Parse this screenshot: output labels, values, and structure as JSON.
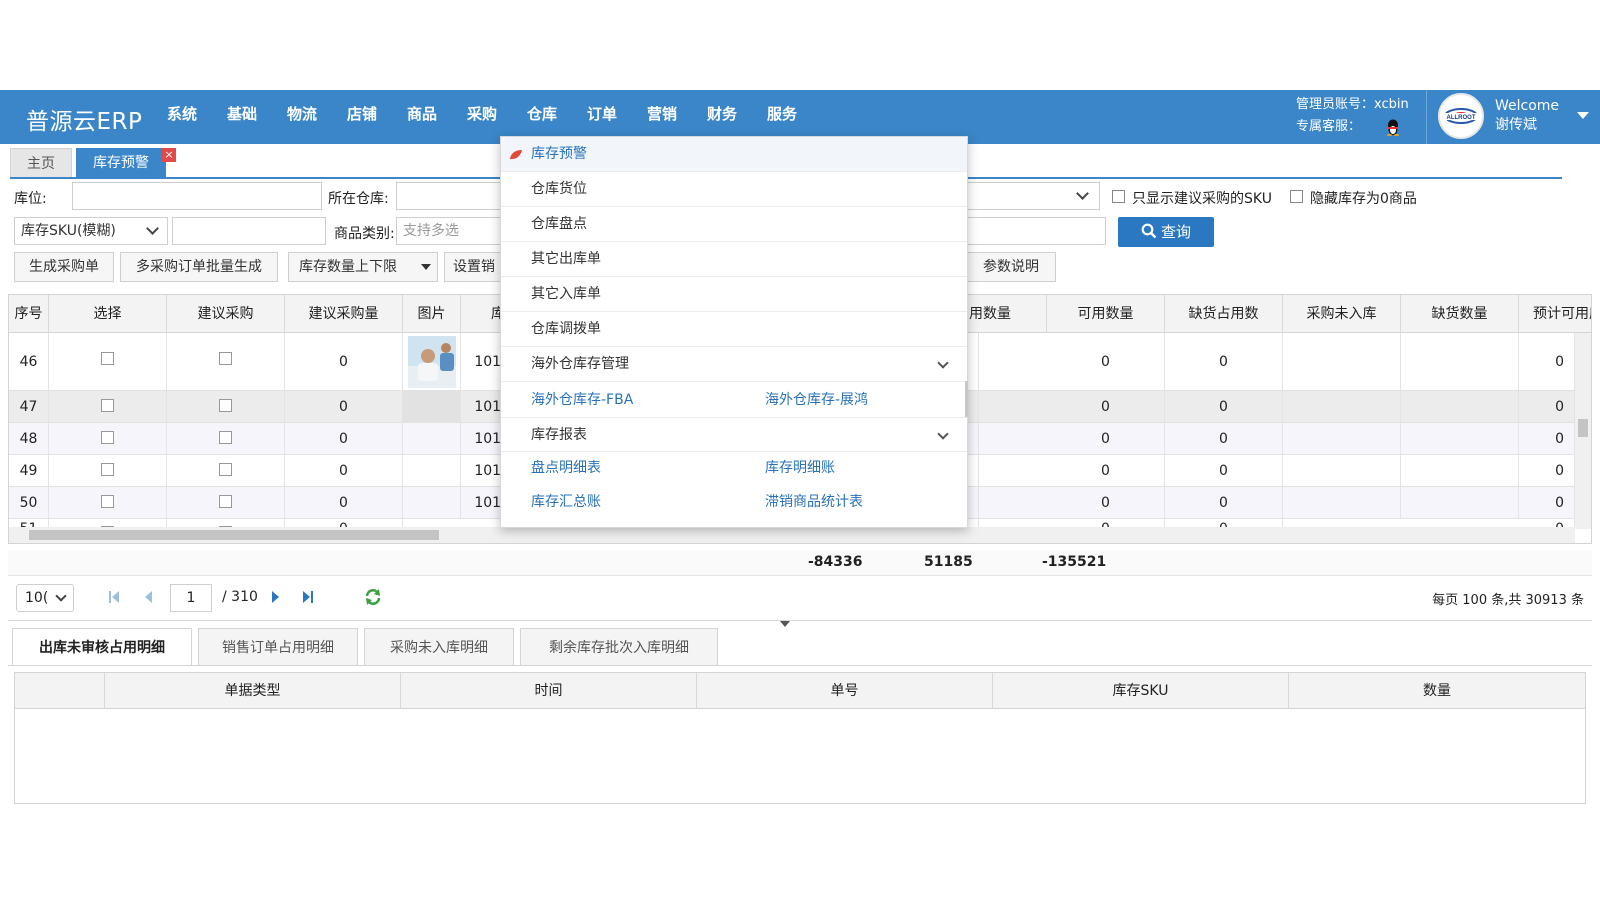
{
  "app": {
    "logo": "普源云ERP"
  },
  "nav": [
    "系统",
    "基础",
    "物流",
    "店铺",
    "商品",
    "采购",
    "仓库",
    "订单",
    "营销",
    "财务",
    "服务"
  ],
  "admin": {
    "account_label": "管理员账号：xcbin",
    "service_label": "专属客服："
  },
  "user": {
    "welcome": "Welcome",
    "name": "谢传斌",
    "logo_text": "ALLROOT"
  },
  "tabs": {
    "home": "主页",
    "active": "库存预警",
    "close": "×"
  },
  "filters": {
    "location_label": "库位:",
    "warehouse_label": "所在仓库:",
    "sku_mode": "库存SKU(模糊)",
    "category_label": "商品类别:",
    "category_placeholder": "支持多选",
    "only_suggest_label": "只显示建议采购的SKU",
    "hide_zero_label": "隐藏库存为0商品",
    "query_button": "查询"
  },
  "actions": [
    "生成采购单",
    "多采购订单批量生成",
    "库存数量上下限",
    "设置销",
    "参数说明"
  ],
  "grid": {
    "headers": [
      "序号",
      "选择",
      "建议采购",
      "建议采购量",
      "图片",
      "库",
      "用数量",
      "可用数量",
      "缺货占用数",
      "采购未入库",
      "缺货数量",
      "预计可用库"
    ],
    "rows": [
      {
        "no": "46",
        "qty": "0",
        "sku": "1010",
        "used": "0",
        "avail": "0",
        "short": "0",
        "eta": "0"
      },
      {
        "no": "47",
        "qty": "0",
        "sku": "1010",
        "used": "0",
        "avail": "0",
        "short": "0",
        "eta": "0"
      },
      {
        "no": "48",
        "qty": "0",
        "sku": "1010",
        "used": "0",
        "avail": "0",
        "short": "0",
        "eta": "0"
      },
      {
        "no": "49",
        "qty": "0",
        "sku": "1010",
        "used": "0",
        "avail": "0",
        "short": "0",
        "eta": "0"
      },
      {
        "no": "50",
        "qty": "0",
        "sku": "1010",
        "used": "0",
        "avail": "0",
        "short": "0",
        "eta": "0"
      },
      {
        "no": "51",
        "qty": "0",
        "sku": "",
        "used": "0",
        "avail": "0",
        "short": "0",
        "eta": "0"
      }
    ],
    "totals": [
      "-84336",
      "51185",
      "-135521"
    ]
  },
  "pager": {
    "page_size": "10(",
    "current_page": "1",
    "total_pages": "/ 310",
    "summary": "每页 100 条,共 30913 条"
  },
  "detail_tabs": [
    "出库未审核占用明细",
    "销售订单占用明细",
    "采购未入库明细",
    "剩余库存批次入库明细"
  ],
  "detail_headers": [
    "单据类型",
    "时间",
    "单号",
    "库存SKU",
    "数量"
  ],
  "menu": {
    "items": [
      "库存预警",
      "仓库货位",
      "仓库盘点",
      "其它出库单",
      "其它入库单",
      "仓库调拨单"
    ],
    "group1": {
      "title": "海外仓库存管理",
      "links": [
        "海外仓库存-FBA",
        "海外仓库存-展鸿"
      ]
    },
    "group2": {
      "title": "库存报表",
      "links": [
        "盘点明细表",
        "库存明细账",
        "库存汇总账",
        "滞销商品统计表"
      ]
    }
  },
  "colors": {
    "primary": "#3a86c8",
    "button": "#2a78c2",
    "link": "#2a72b8",
    "danger": "#e04a4a"
  }
}
